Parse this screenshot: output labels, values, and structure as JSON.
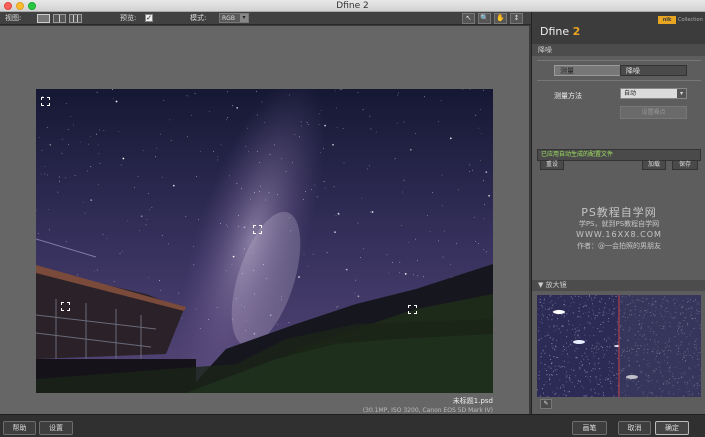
{
  "window": {
    "title": "Dfine 2"
  },
  "toolbar": {
    "view_label": "视图:",
    "preview_label": "预览:",
    "preview_checked": "✓",
    "mode_label": "模式:",
    "mode_value": "RGB",
    "tools": [
      "↖",
      "🔍",
      "✋",
      "↕"
    ]
  },
  "canvas": {
    "filename": "未标题1.psd",
    "meta": "(30.1MP, ISO 3200, Canon EOS 5D Mark IV)"
  },
  "panel": {
    "brand_name": "Dfine ",
    "brand_version": "2",
    "nik_badge": "nik",
    "collection": "Collection",
    "section_header": "降噪",
    "tab_measure": "测量",
    "tab_detail": "降噪",
    "method_label": "测量方法",
    "method_value": "自动",
    "edit_button": "设置噪点",
    "status": "已应用自动生成的配置文件",
    "reset_button": "重设",
    "load_button": "加载",
    "save_button": "保存",
    "loupe_header": "▼ 放大镜",
    "loupe_pin": "✎"
  },
  "watermark": {
    "line1": "PS教程自学网",
    "line2": "学PS，就到PS教程自学网",
    "line3": "WWW.16XX8.COM",
    "line4": "作者：@一会拍照的男朋友"
  },
  "bottom": {
    "help": "帮助",
    "settings": "设置",
    "brush": "画笔",
    "cancel": "取消",
    "ok": "确定"
  },
  "colors": {
    "accent": "#e8a522",
    "status_green": "#9fe060"
  }
}
